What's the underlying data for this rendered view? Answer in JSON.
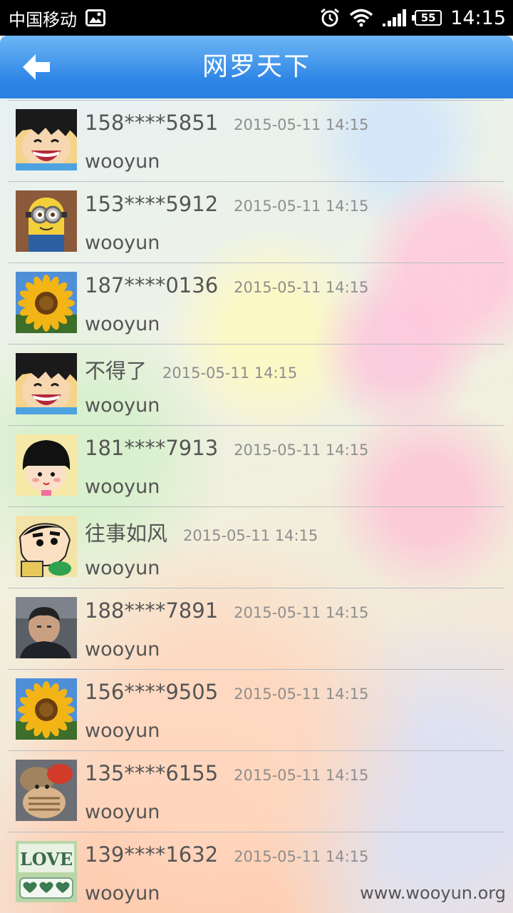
{
  "status_bar": {
    "carrier": "中国移动",
    "battery": "55",
    "time": "14:15",
    "icons": [
      "image-icon",
      "alarm-icon",
      "wifi-icon",
      "signal-icon",
      "battery-icon"
    ]
  },
  "header": {
    "title": "网罗天下",
    "back_icon": "back-arrow-icon",
    "color": "#2f86e6"
  },
  "list": [
    {
      "name": "158****5851",
      "time": "2015-05-11 14:15",
      "message": "wooyun",
      "avatar": "luffy"
    },
    {
      "name": "153****5912",
      "time": "2015-05-11 14:15",
      "message": "wooyun",
      "avatar": "minion"
    },
    {
      "name": "187****0136",
      "time": "2015-05-11 14:15",
      "message": "wooyun",
      "avatar": "sunflower"
    },
    {
      "name": "不得了",
      "time": "2015-05-11 14:15",
      "message": "wooyun",
      "avatar": "luffy"
    },
    {
      "name": "181****7913",
      "time": "2015-05-11 14:15",
      "message": "wooyun",
      "avatar": "maruko"
    },
    {
      "name": "往事如风",
      "time": "2015-05-11 14:15",
      "message": "wooyun",
      "avatar": "shinchan"
    },
    {
      "name": "188****7891",
      "time": "2015-05-11 14:15",
      "message": "wooyun",
      "avatar": "photo"
    },
    {
      "name": "156****9505",
      "time": "2015-05-11 14:15",
      "message": "wooyun",
      "avatar": "sunflower"
    },
    {
      "name": "135****6155",
      "time": "2015-05-11 14:15",
      "message": "wooyun",
      "avatar": "toy"
    },
    {
      "name": "139****1632",
      "time": "2015-05-11 14:15",
      "message": "wooyun",
      "avatar": "love"
    }
  ],
  "watermark": "www.wooyun.org"
}
